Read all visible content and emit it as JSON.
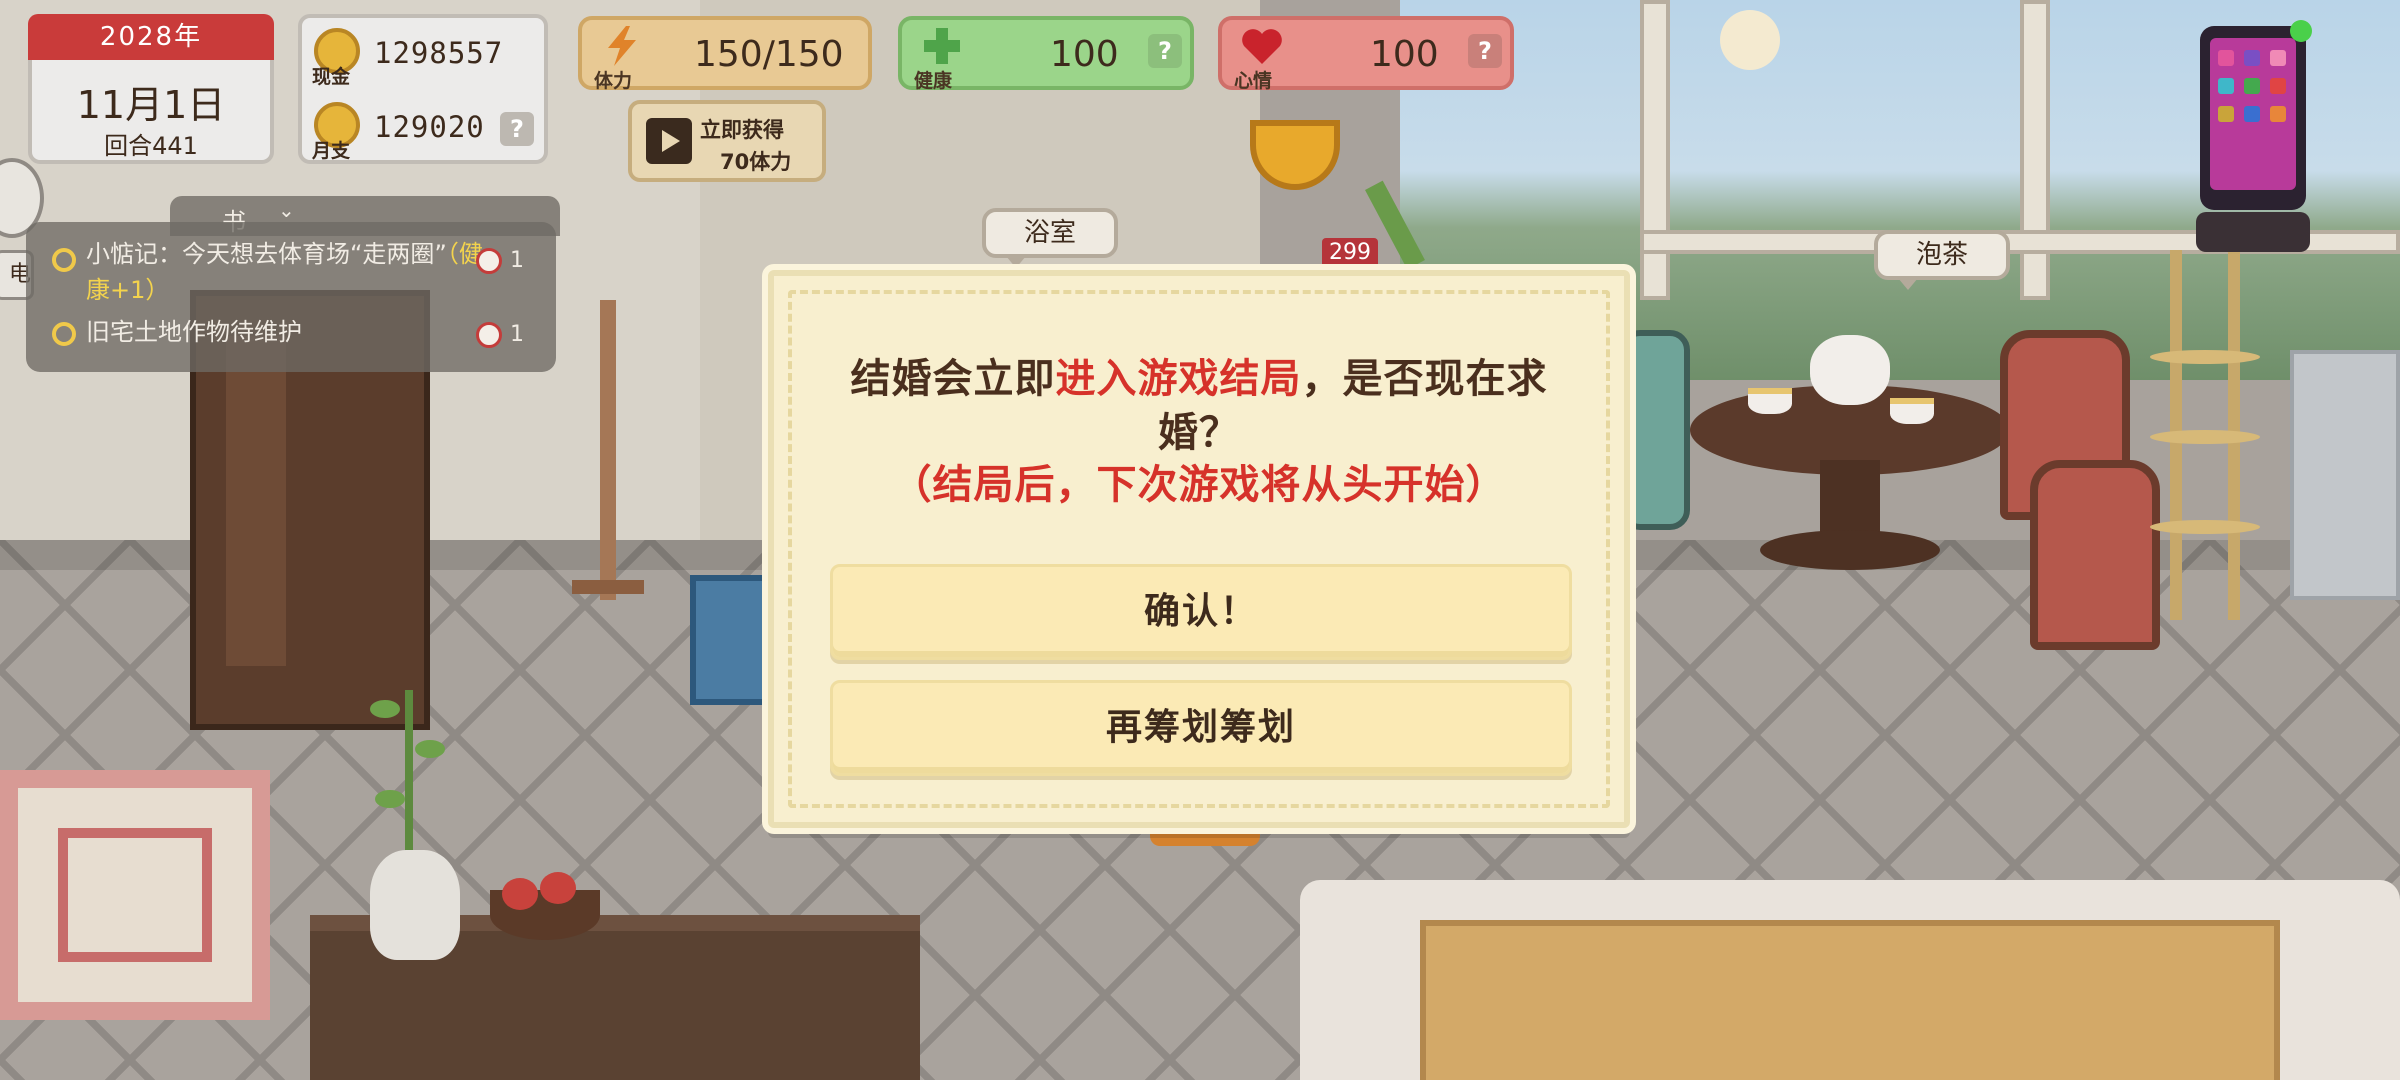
{
  "hud": {
    "date": {
      "year": "2028年",
      "month_day": "11月1日",
      "round": "回合441"
    },
    "money": {
      "cash_label": "现金",
      "cash_value": "1298557",
      "monthly_label": "月支",
      "monthly_value": "129020",
      "help": "?"
    },
    "stats": {
      "energy": {
        "label": "体力",
        "value": "150/150",
        "icon": "lightning-icon",
        "color": "#e8c994"
      },
      "health": {
        "label": "健康",
        "value": "100",
        "icon": "cross-icon",
        "help": "?",
        "color": "#9bd58a"
      },
      "mood": {
        "label": "心情",
        "value": "100",
        "icon": "heart-icon",
        "help": "?",
        "color": "#e8908a"
      }
    },
    "video_offer": {
      "line1": "立即获得",
      "line2": "70体力",
      "icon": "film-icon"
    }
  },
  "left_panel": {
    "tab_label": "书",
    "side_label": "电脑",
    "tasks": [
      {
        "text_main": "小惦记：今天想去体育场“走两圈”",
        "text_highlight": "（健康+1）",
        "count": "1"
      },
      {
        "text_main": "旧宅土地作物待维护",
        "text_highlight": "",
        "count": "1"
      }
    ]
  },
  "scene_labels": {
    "bathroom": "浴室",
    "make_tea": "泡茶",
    "badge_value": "299"
  },
  "dialog": {
    "message_prefix": "结婚会立即",
    "message_highlight": "进入游戏结局",
    "message_suffix": "，是否现在求婚？",
    "warning": "（结局后，下次游戏将从头开始）",
    "confirm_label": "确认！",
    "later_label": "再筹划筹划"
  },
  "colors": {
    "accent_red": "#d6322a",
    "dialog_bg": "#f8efcf",
    "button_bg": "#fbeab5"
  }
}
